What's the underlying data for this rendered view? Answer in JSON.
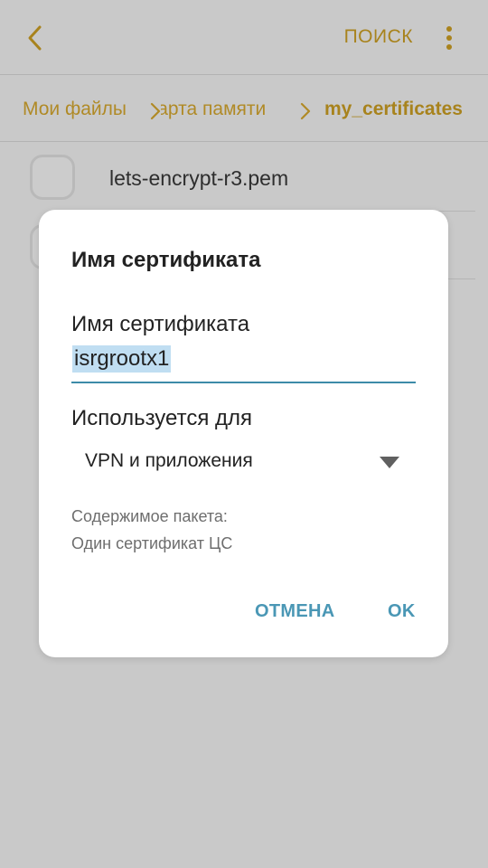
{
  "app_bar": {
    "search_label": "ПОИСК",
    "back_icon": "chevron-left-icon",
    "menu_icon": "more-vertical-icon"
  },
  "breadcrumb": {
    "items": [
      "Мои файлы",
      "Карта памяти",
      "my_certificates"
    ],
    "separator_icon": "chevron-right-icon"
  },
  "files": [
    {
      "name": "lets-encrypt-r3.pem"
    }
  ],
  "dialog": {
    "title": "Имя сертификата",
    "name_label": "Имя сертификата",
    "name_value": "isrgrootx1",
    "used_for_label": "Используется для",
    "used_for_value": "VPN и приложения",
    "package_label": "Содержимое пакета:",
    "package_value": "Один сертификат ЦС",
    "cancel_label": "ОТМЕНА",
    "ok_label": "OK"
  },
  "colors": {
    "accent": "#a8831d",
    "dialog_button": "#4a97b5",
    "input_underline": "#3d8ba8",
    "selection": "#c0def2",
    "scrim_background": "#c9c9c9"
  }
}
